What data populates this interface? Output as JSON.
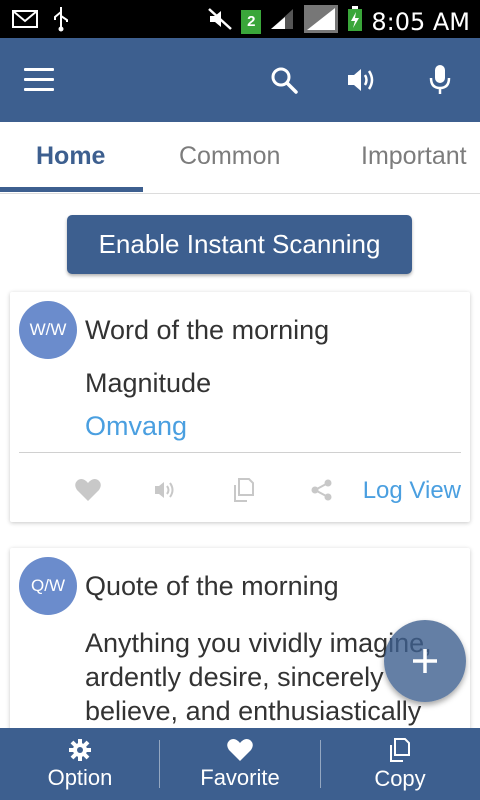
{
  "status_bar": {
    "sim_slot": "2",
    "time": "8:05 AM",
    "icons": [
      "mail-icon",
      "usb-icon",
      "mute-icon",
      "sim-icon",
      "signal-icon",
      "signal-icon",
      "battery-charging-icon"
    ]
  },
  "app_bar": {
    "color": "#3d5f8f",
    "icons": [
      "menu-icon",
      "search-icon",
      "speaker-icon",
      "microphone-icon"
    ]
  },
  "tabs": [
    {
      "label": "Home",
      "active": true
    },
    {
      "label": "Common",
      "active": false
    },
    {
      "label": "Important",
      "active": false
    }
  ],
  "enable_button": {
    "label": "Enable Instant Scanning"
  },
  "word_card": {
    "badge": "W/W",
    "title": "Word of the morning",
    "word": "Magnitude",
    "translation": "Omvang",
    "log_view_label": "Log View",
    "action_icons": [
      "heart-icon",
      "speaker-icon",
      "copy-icon",
      "share-icon"
    ]
  },
  "quote_card": {
    "badge": "Q/W",
    "title": "Quote of the morning",
    "text": "Anything you vividly imagine, ardently desire, sincerely believe, and enthusiastically"
  },
  "fab": {
    "icon": "plus-icon"
  },
  "bottom_nav": [
    {
      "label": "Option",
      "icon": "gear-icon"
    },
    {
      "label": "Favorite",
      "icon": "heart-icon"
    },
    {
      "label": "Copy",
      "icon": "copy-icon"
    }
  ],
  "colors": {
    "primary": "#3d5f8f",
    "badge": "#6b8ccc",
    "link": "#4a9fe0"
  }
}
